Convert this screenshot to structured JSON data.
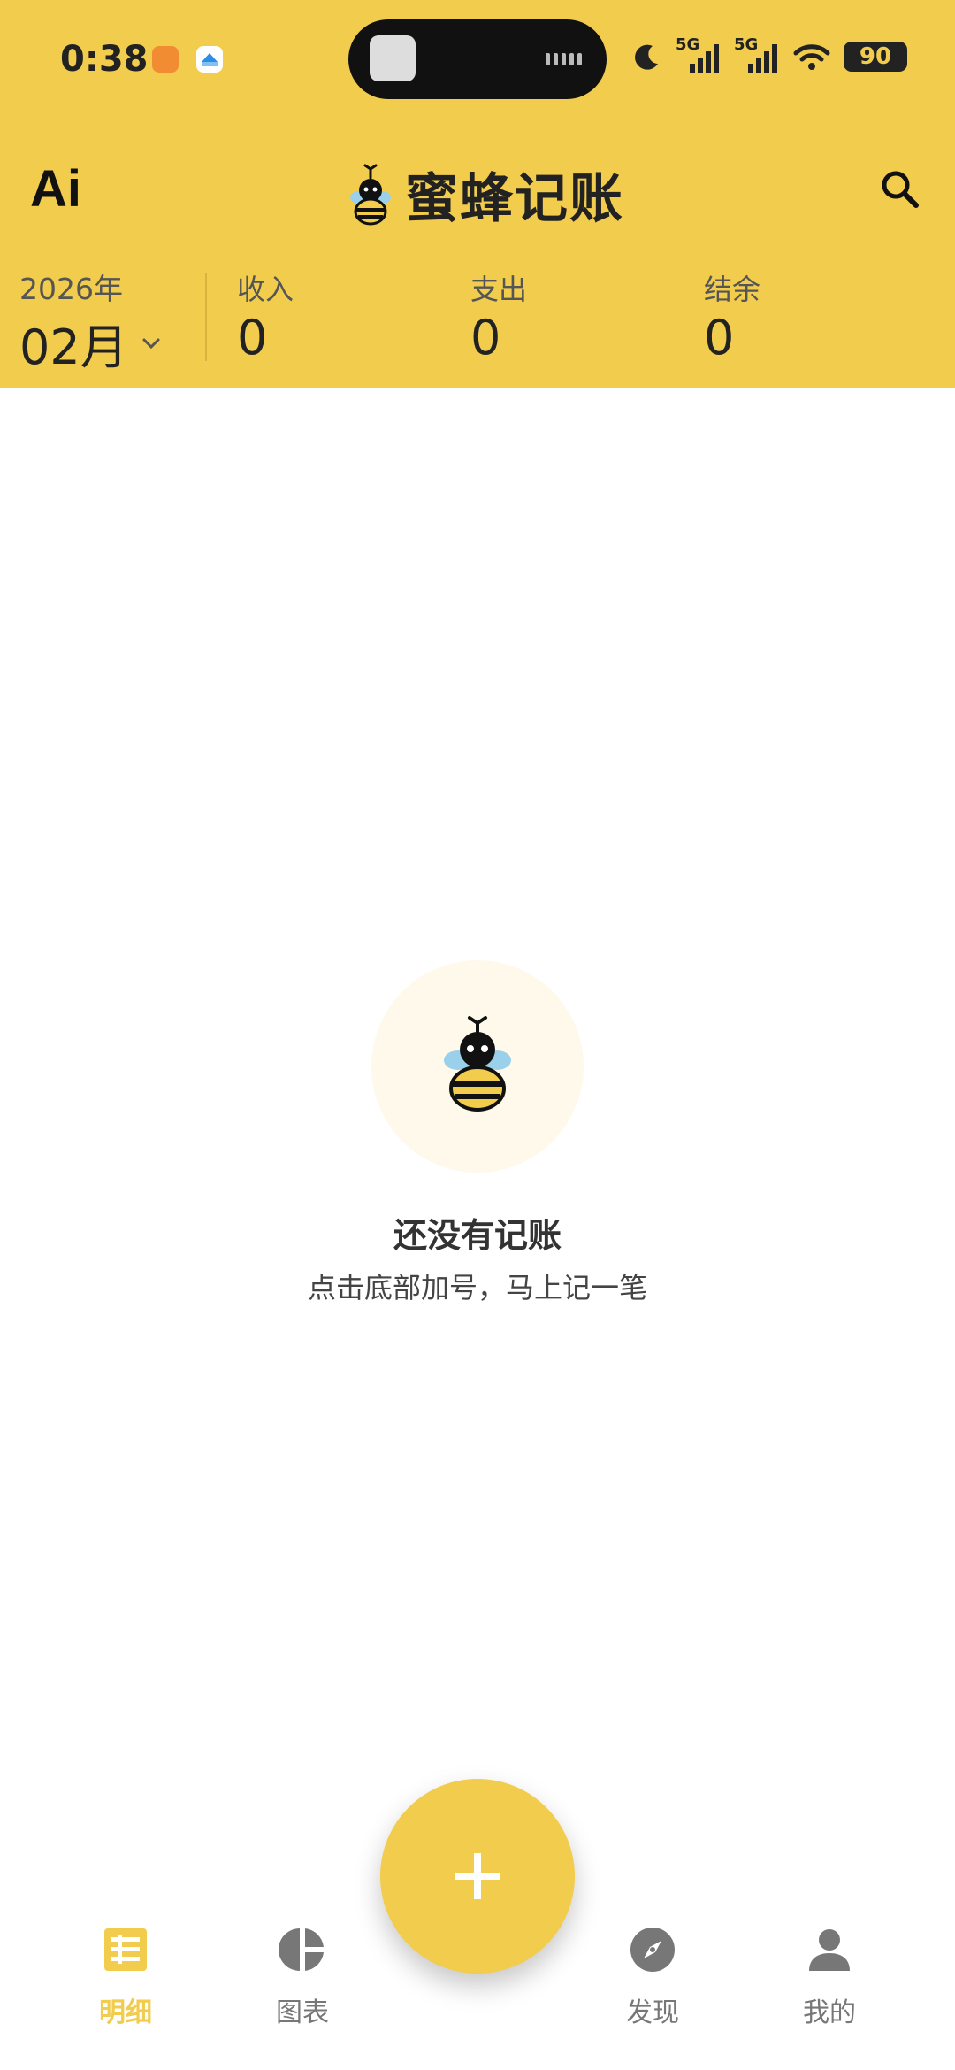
{
  "status_bar": {
    "time": "0:38",
    "signal_1": "5G",
    "signal_2": "5G",
    "battery": "90"
  },
  "header": {
    "ai_button": "Ai",
    "app_title": "蜜蜂记账",
    "year": "2026年",
    "month": "02月",
    "income_label": "收入",
    "income_value": "0",
    "expense_label": "支出",
    "expense_value": "0",
    "balance_label": "结余",
    "balance_value": "0"
  },
  "empty_state": {
    "title": "还没有记账",
    "subtitle": "点击底部加号，马上记一笔"
  },
  "tabs": [
    {
      "label": "明细",
      "icon": "list-icon",
      "active": true
    },
    {
      "label": "图表",
      "icon": "pie-chart-icon",
      "active": false
    },
    {
      "label": "发现",
      "icon": "compass-icon",
      "active": false
    },
    {
      "label": "我的",
      "icon": "person-icon",
      "active": false
    }
  ],
  "colors": {
    "accent": "#F2CC4D",
    "empty_circle": "#FEF9EA"
  }
}
